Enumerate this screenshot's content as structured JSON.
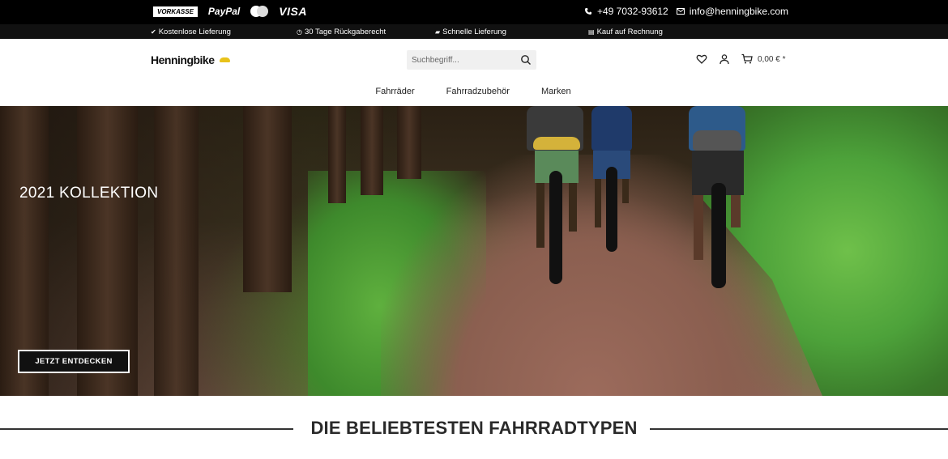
{
  "topbar": {
    "payments": {
      "vorkasse": "VORKASSE",
      "paypal": "PayPal",
      "visa": "VISA"
    },
    "phone": "+49 7032-93612",
    "email": "info@henningbike.com"
  },
  "usp": [
    {
      "icon": "leaf-icon",
      "label": "Kostenlose Lieferung"
    },
    {
      "icon": "clock-icon",
      "label": "30 Tage Rückgaberecht"
    },
    {
      "icon": "truck-icon",
      "label": "Schnelle Lieferung"
    },
    {
      "icon": "invoice-icon",
      "label": "Kauf auf Rechnung"
    }
  ],
  "header": {
    "logo": "Henningbike",
    "search_placeholder": "Suchbegriff...",
    "cart_total": "0,00 € *"
  },
  "nav": [
    {
      "label": "Fahrräder"
    },
    {
      "label": "Fahrradzubehör"
    },
    {
      "label": "Marken"
    }
  ],
  "hero": {
    "title": "2021 KOLLEKTION",
    "cta": "JETZT ENTDECKEN"
  },
  "section": {
    "title": "DIE BELIEBTESTEN FAHRRADTYPEN"
  },
  "colors": {
    "topbar_bg": "#000000",
    "logo_accent": "#e8c21a",
    "section_rule": "#333333"
  }
}
